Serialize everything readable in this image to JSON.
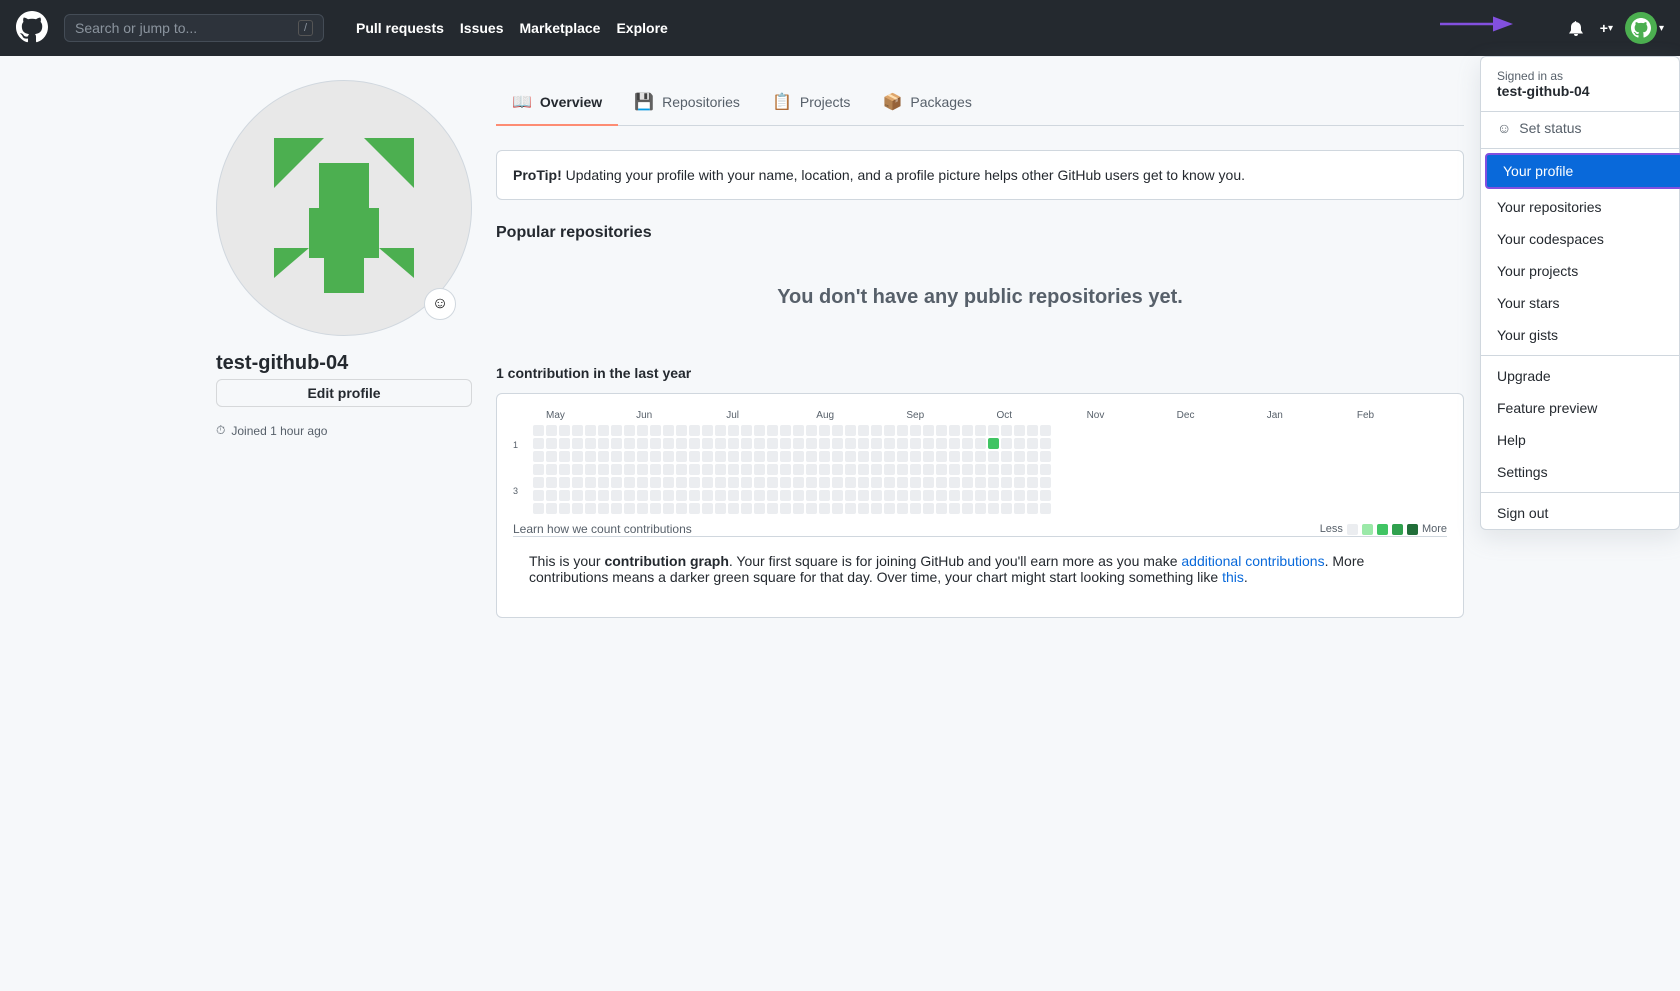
{
  "nav": {
    "search_placeholder": "Search or jump to...",
    "search_slash": "/",
    "links": [
      {
        "label": "Pull requests",
        "href": "#"
      },
      {
        "label": "Issues",
        "href": "#"
      },
      {
        "label": "Marketplace",
        "href": "#"
      },
      {
        "label": "Explore",
        "href": "#"
      }
    ],
    "notification_icon": "🔔",
    "plus_icon": "+",
    "avatar_color": "#4caf50"
  },
  "dropdown": {
    "signed_in_label": "Signed in as",
    "username": "test-github-04",
    "set_status": "Set status",
    "items": [
      {
        "label": "Your profile",
        "active": true
      },
      {
        "label": "Your repositories",
        "active": false
      },
      {
        "label": "Your codespaces",
        "active": false
      },
      {
        "label": "Your projects",
        "active": false
      },
      {
        "label": "Your stars",
        "active": false
      },
      {
        "label": "Your gists",
        "active": false
      }
    ],
    "items2": [
      {
        "label": "Upgrade"
      },
      {
        "label": "Feature preview"
      },
      {
        "label": "Help"
      },
      {
        "label": "Settings"
      }
    ],
    "sign_out": "Sign out"
  },
  "profile": {
    "username": "test-github-04",
    "edit_profile_label": "Edit profile",
    "joined_label": "Joined 1 hour ago"
  },
  "tabs": [
    {
      "label": "Overview",
      "icon": "📖",
      "active": true
    },
    {
      "label": "Repositories",
      "icon": "💾",
      "active": false
    },
    {
      "label": "Projects",
      "icon": "📋",
      "active": false
    },
    {
      "label": "Packages",
      "icon": "📦",
      "active": false
    }
  ],
  "protip": {
    "prefix": "ProTip!",
    "text": " Updating your profile with your name, location, and a profile picture helps other GitHub users get to know you."
  },
  "popular_repos": {
    "title": "Popular repositories",
    "empty_text": "You don't have any public repositories yet."
  },
  "contributions": {
    "header": "1 contribution in the last year",
    "months": [
      "May",
      "Jun",
      "Jul",
      "Aug",
      "Sep",
      "Oct",
      "Nov",
      "Dec",
      "Jan",
      "Feb"
    ],
    "learn_link": "Learn how we count contributions",
    "legend_less": "Less",
    "legend_more": "More",
    "contrib_text_part1": "This is your ",
    "contrib_text_bold": "contribution graph",
    "contrib_text_part2": ". Your first square is for joining GitHub and you'll earn more as you make ",
    "contrib_text_link1": "additional contributions",
    "contrib_text_part3": ". More contributions means a darker green square for that day. Over time, your chart might start looking something like ",
    "contrib_text_link2": "this",
    "contrib_text_part4": "."
  }
}
